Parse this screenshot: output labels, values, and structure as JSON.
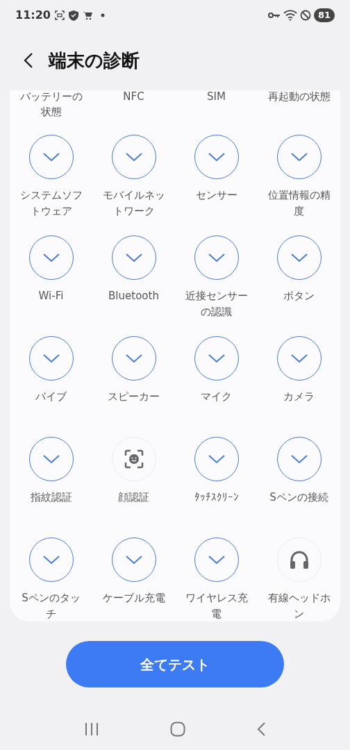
{
  "status_bar": {
    "time": "11:20",
    "battery": "81"
  },
  "header": {
    "title": "端末の診断"
  },
  "top_labels": [
    "バッテリーの状態",
    "NFC",
    "SIM",
    "再起動の状態"
  ],
  "tests": [
    {
      "label": "システムソフトウェア",
      "kind": "passed"
    },
    {
      "label": "モバイルネットワーク",
      "kind": "passed"
    },
    {
      "label": "センサー",
      "kind": "passed"
    },
    {
      "label": "位置情報の精度",
      "kind": "passed"
    },
    {
      "label": "Wi-Fi",
      "kind": "passed"
    },
    {
      "label": "Bluetooth",
      "kind": "passed"
    },
    {
      "label": "近接センサーの認識",
      "kind": "passed"
    },
    {
      "label": "ボタン",
      "kind": "passed"
    },
    {
      "label": "バイブ",
      "kind": "passed"
    },
    {
      "label": "スピーカー",
      "kind": "passed"
    },
    {
      "label": "マイク",
      "kind": "passed"
    },
    {
      "label": "カメラ",
      "kind": "passed"
    },
    {
      "label": "指紋認証",
      "kind": "passed"
    },
    {
      "label": "顔認証",
      "kind": "face"
    },
    {
      "label": "ﾀｯﾁｽｸﾘｰﾝ",
      "kind": "passed"
    },
    {
      "label": "Sペンの接続",
      "kind": "passed"
    },
    {
      "label": "Sペンのタッチ",
      "kind": "passed"
    },
    {
      "label": "ケーブル充電",
      "kind": "passed"
    },
    {
      "label": "ワイヤレス充電",
      "kind": "passed"
    },
    {
      "label": "有線ヘッドホン",
      "kind": "headphones"
    }
  ],
  "button": "全てテスト"
}
